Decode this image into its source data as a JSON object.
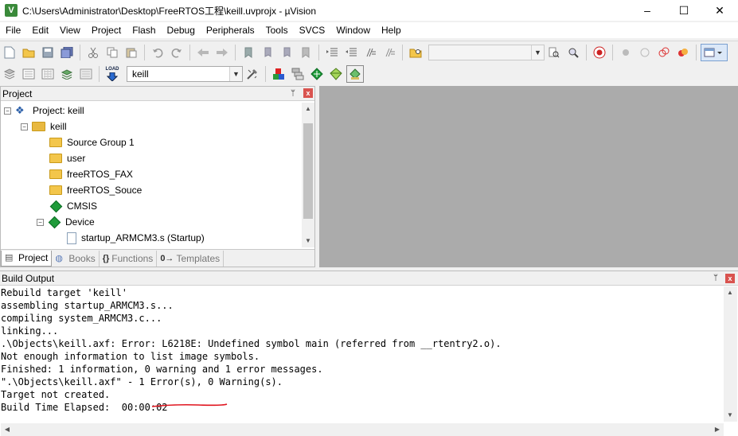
{
  "titlebar": {
    "title": "C:\\Users\\Administrator\\Desktop\\FreeRTOS工程\\keill.uvprojx - µVision",
    "app_icon": "V",
    "minimize": "–",
    "maximize": "☐",
    "close": "✕"
  },
  "menu": [
    "File",
    "Edit",
    "View",
    "Project",
    "Flash",
    "Debug",
    "Peripherals",
    "Tools",
    "SVCS",
    "Window",
    "Help"
  ],
  "toolbar1": {
    "icons": [
      "new-file-icon",
      "open-folder-icon",
      "save-icon",
      "save-all-icon",
      "cut-icon",
      "copy-icon",
      "paste-icon",
      "undo-icon",
      "redo-icon",
      "navigate-back-icon",
      "navigate-forward-icon",
      "bookmark-icon",
      "prev-bookmark-icon",
      "next-bookmark-icon",
      "clear-bookmarks-icon",
      "indent-icon",
      "unindent-icon",
      "comment-icon",
      "uncomment-icon",
      "find-in-files-icon",
      "search-combo",
      "find-icon",
      "incremental-find-icon",
      "debug-session-icon",
      "breakpoint-icon",
      "disable-breakpoint-icon",
      "disable-all-breakpoints-icon",
      "kill-all-breakpoints-icon",
      "window-layout-icon"
    ],
    "find_value": ""
  },
  "toolbar2": {
    "icons": [
      "translate-icon",
      "build-icon",
      "rebuild-icon",
      "batch-build-icon",
      "stop-build-icon",
      "download-icon",
      "target-options-icon",
      "manage-components-icon",
      "select-packs-icon",
      "pack-installer-icon",
      "event-recorder-icon"
    ],
    "load_label": "LOAD",
    "target_value": "keill"
  },
  "project_panel": {
    "title": "Project",
    "pin": "ᛘ",
    "close": "x",
    "tree": [
      {
        "label": "Project: keill",
        "level": 0,
        "icon": "project-icon",
        "expander": "−"
      },
      {
        "label": "keill",
        "level": 1,
        "icon": "target-folder-icon",
        "expander": "−"
      },
      {
        "label": "Source Group 1",
        "level": 2,
        "icon": "folder-icon",
        "expander": ""
      },
      {
        "label": "user",
        "level": 2,
        "icon": "folder-icon",
        "expander": ""
      },
      {
        "label": "freeRTOS_FAX",
        "level": 2,
        "icon": "folder-icon",
        "expander": ""
      },
      {
        "label": "freeRTOS_Souce",
        "level": 2,
        "icon": "folder-icon",
        "expander": ""
      },
      {
        "label": "CMSIS",
        "level": 2,
        "icon": "green-diamond-icon",
        "expander": ""
      },
      {
        "label": "Device",
        "level": 2,
        "icon": "green-diamond-icon",
        "expander": "−"
      },
      {
        "label": "startup_ARMCM3.s (Startup)",
        "level": 3,
        "icon": "file-icon",
        "expander": ""
      }
    ],
    "tabs": [
      {
        "label": "Project",
        "icon": "project-tab-icon",
        "active": true
      },
      {
        "label": "Books",
        "icon": "books-icon",
        "active": false
      },
      {
        "label": "Functions",
        "icon": "functions-icon",
        "glyph": "{}",
        "active": false
      },
      {
        "label": "Templates",
        "icon": "templates-icon",
        "glyph": "0→",
        "active": false
      }
    ]
  },
  "build_output": {
    "title": "Build Output",
    "pin": "ᛘ",
    "close": "x",
    "lines": [
      "Rebuild target 'keill'",
      "assembling startup_ARMCM3.s...",
      "compiling system_ARMCM3.c...",
      "linking...",
      ".\\Objects\\keill.axf: Error: L6218E: Undefined symbol main (referred from __rtentry2.o).",
      "Not enough information to list image symbols.",
      "Finished: 1 information, 0 warning and 1 error messages.",
      "\".\\Objects\\keill.axf\" - 1 Error(s), 0 Warning(s).",
      "Target not created.",
      "Build Time Elapsed:  00:00:02"
    ],
    "annotation_color": "#e0141e"
  },
  "colors": {
    "editor_background": "#ababab",
    "folder": "#f3c64b",
    "device_diamond": "#1f9b3a"
  }
}
